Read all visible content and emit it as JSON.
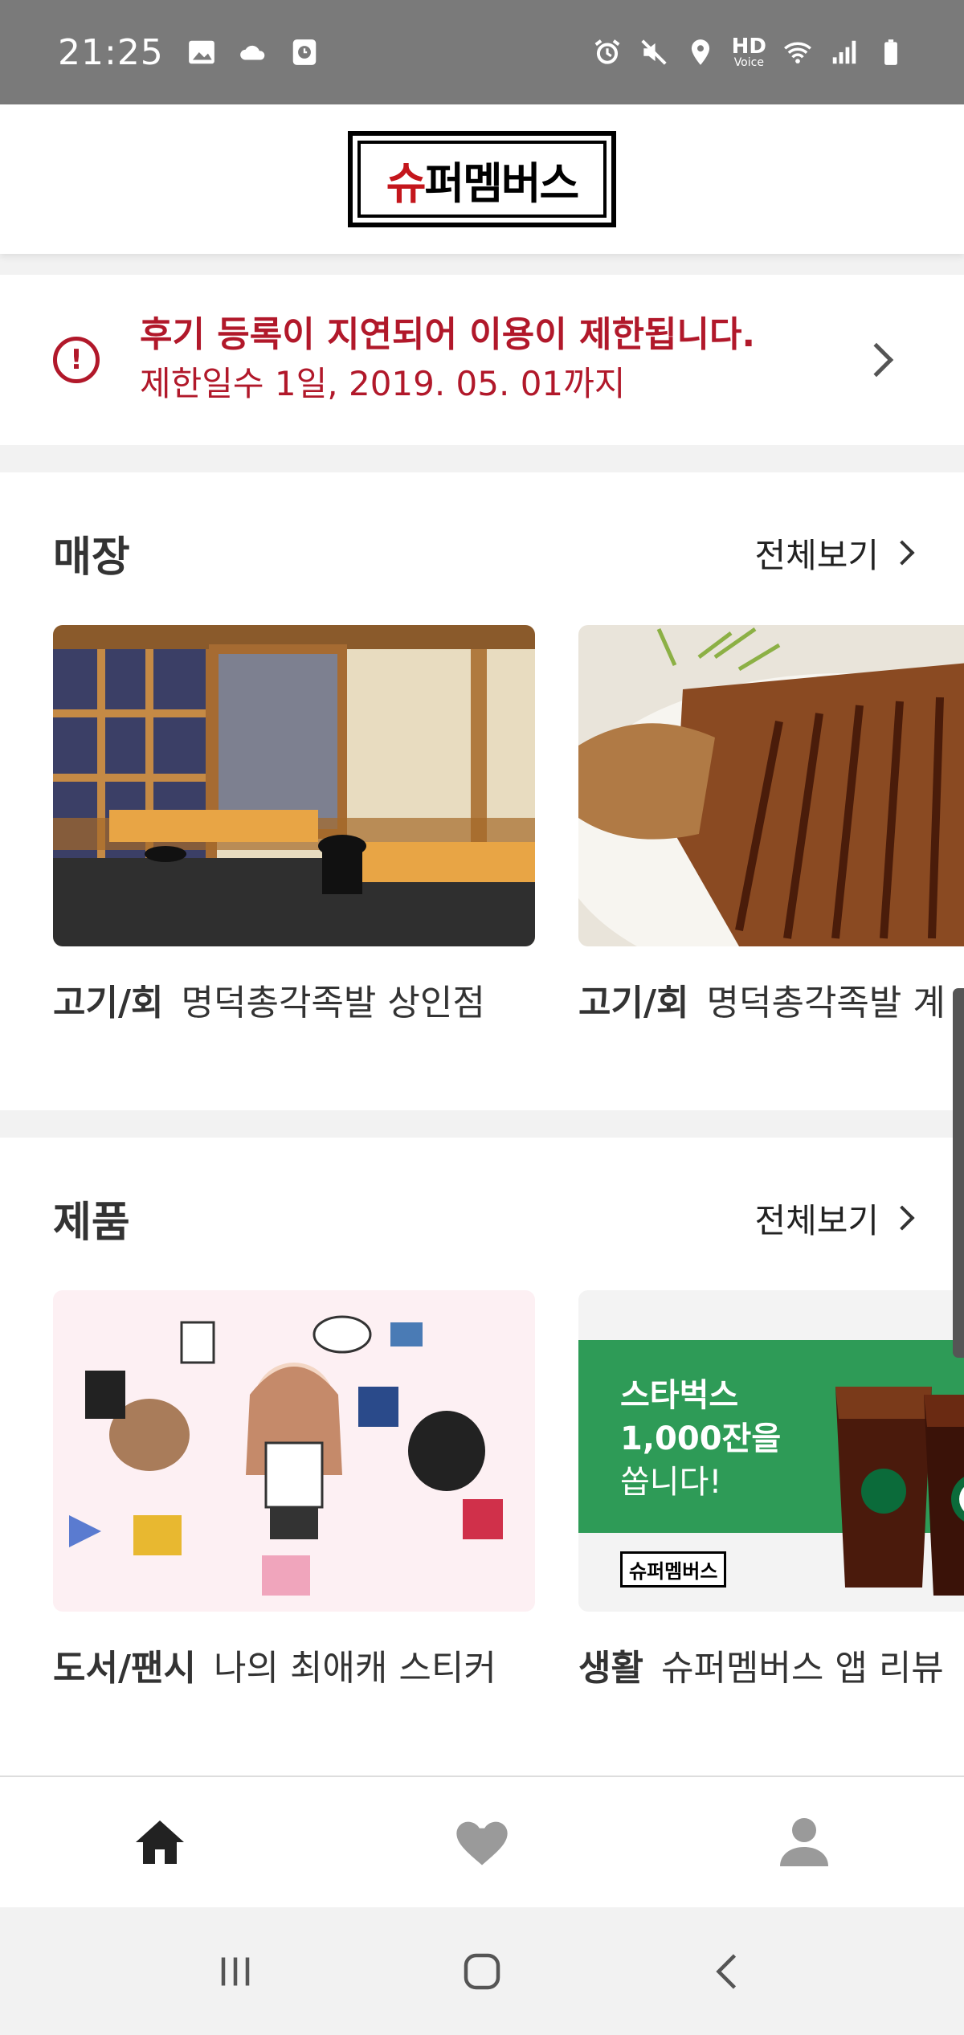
{
  "status_bar": {
    "time": "21:25",
    "left_icons": [
      "image-icon",
      "cloud-icon",
      "clock-icon"
    ],
    "right_icons": [
      "alarm-icon",
      "mute-icon",
      "location-icon",
      "hd-voice-icon",
      "wifi-icon",
      "signal-icon",
      "battery-icon"
    ],
    "hd_text": "HD",
    "voice_text": "Voice"
  },
  "header": {
    "logo_text_red": "슈",
    "logo_text_black": "퍼멤버스"
  },
  "alert": {
    "icon": "alert-circle-icon",
    "title": "후기 등록이 지연되어 이용이 제한됩니다.",
    "detail": "제한일수 1일, 2019. 05. 01까지",
    "color": "#b1182a"
  },
  "stores": {
    "title": "매장",
    "see_all": "전체보기",
    "items": [
      {
        "category": "고기/회",
        "name": "명덕총각족발 상인점"
      },
      {
        "category": "고기/회",
        "name": "명덕총각족발 계"
      }
    ]
  },
  "products": {
    "title": "제품",
    "see_all": "전체보기",
    "items": [
      {
        "category": "도서/팬시",
        "name": "나의 최애캐 스티커"
      },
      {
        "category": "생활",
        "name": "슈퍼멤버스 앱 리뷰"
      }
    ],
    "promo": {
      "line1": "스타벅스",
      "line2": "1,000잔을",
      "line3": "쏩니다!",
      "brand": "슈퍼멤버스",
      "bg": "#2e9b57"
    }
  },
  "bottom_nav": {
    "items": [
      "home-icon",
      "heart-icon",
      "profile-icon"
    ]
  },
  "system_nav": {
    "items": [
      "recent-apps-icon",
      "home-circle-icon",
      "back-icon"
    ]
  }
}
